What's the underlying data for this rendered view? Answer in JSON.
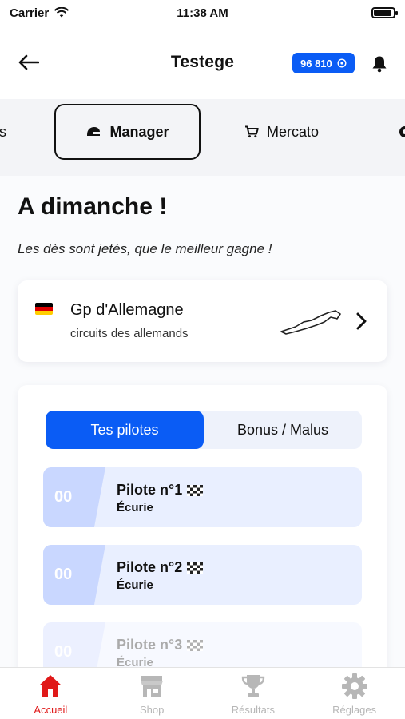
{
  "status_bar": {
    "carrier": "Carrier",
    "time": "11:38 AM"
  },
  "header": {
    "title": "Testege",
    "credits": "96 810"
  },
  "tabs": [
    {
      "label": "ts"
    },
    {
      "label": "Manager",
      "active": true
    },
    {
      "label": "Mercato"
    }
  ],
  "main": {
    "heading": "A dimanche !",
    "subtitle": "Les dès sont jetés, que le meilleur gagne !",
    "gp": {
      "name": "Gp d'Allemagne",
      "subtitle": "circuits des allemands"
    },
    "segment": {
      "left": "Tes pilotes",
      "right": "Bonus / Malus"
    },
    "pilots": [
      {
        "num": "00",
        "name": "Pilote n°1",
        "team": "Écurie"
      },
      {
        "num": "00",
        "name": "Pilote n°2",
        "team": "Écurie"
      },
      {
        "num": "00",
        "name": "Pilote n°3",
        "team": "Écurie"
      }
    ]
  },
  "bottom_nav": [
    {
      "label": "Accueil",
      "icon": "home-icon",
      "active": true
    },
    {
      "label": "Shop",
      "icon": "shop-icon"
    },
    {
      "label": "Résultats",
      "icon": "trophy-icon"
    },
    {
      "label": "Réglages",
      "icon": "gear-icon"
    }
  ],
  "colors": {
    "accent": "#0a5cf5",
    "active_nav": "#e01919"
  }
}
